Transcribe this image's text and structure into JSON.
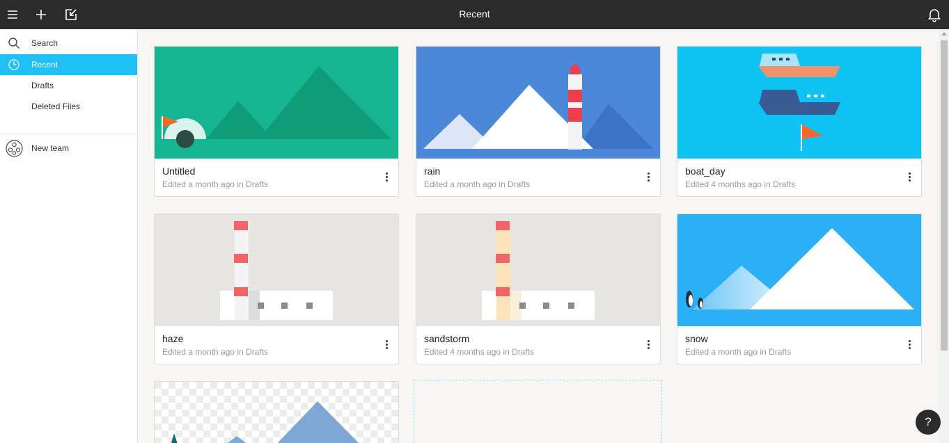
{
  "topbar": {
    "title": "Recent",
    "icons": [
      "menu-icon",
      "plus-icon",
      "import-icon",
      "bell-icon"
    ]
  },
  "sidebar": {
    "items": [
      {
        "label": "Search",
        "icon": "search-icon"
      },
      {
        "label": "Recent",
        "icon": "clock-icon",
        "active": true
      },
      {
        "label": "Drafts"
      },
      {
        "label": "Deleted Files"
      }
    ],
    "team": {
      "label": "New team",
      "icon": "team-icon"
    }
  },
  "files": [
    {
      "name": "Untitled",
      "meta": "Edited a month ago in Drafts"
    },
    {
      "name": "rain",
      "meta": "Edited a month ago in Drafts"
    },
    {
      "name": "boat_day",
      "meta": "Edited 4 months ago in Drafts"
    },
    {
      "name": "haze",
      "meta": "Edited a month ago in Drafts"
    },
    {
      "name": "sandstorm",
      "meta": "Edited 4 months ago in Drafts"
    },
    {
      "name": "snow",
      "meta": "Edited a month ago in Drafts"
    }
  ],
  "help": {
    "label": "?"
  },
  "colors": {
    "accent": "#1ec0f6",
    "topbar": "#2b2b2b"
  }
}
